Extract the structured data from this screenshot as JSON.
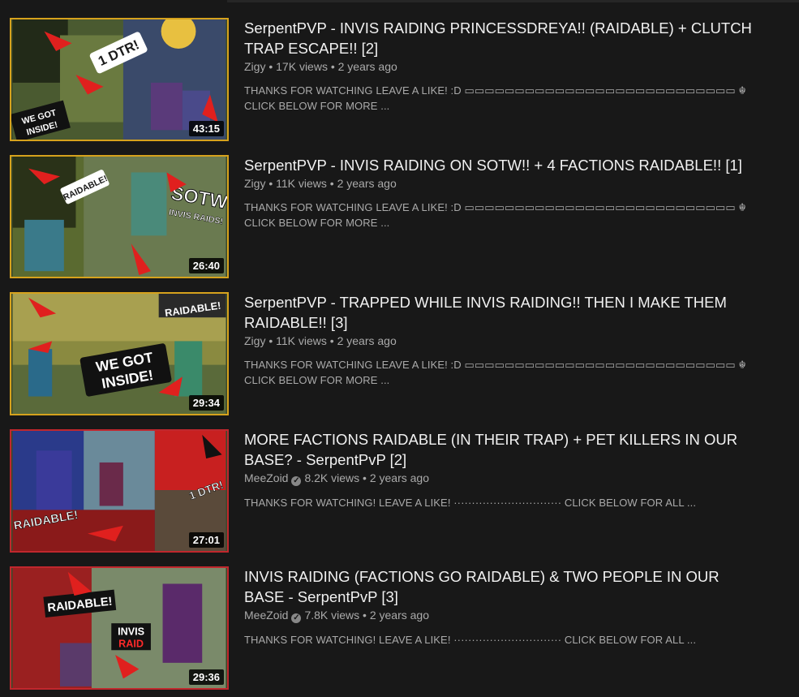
{
  "videos": [
    {
      "title": "SerpentPVP - INVIS RAIDING PRINCESSDREYA!! (RAIDABLE) + CLUTCH TRAP ESCAPE!! [2]",
      "channel": "Zigy",
      "verified": false,
      "stats": "17K views • 2 years ago",
      "description_line1": "THANKS FOR WATCHING LEAVE A LIKE! :D ▭▭▭▭▭▭▭▭▭▭▭▭▭▭▭▭▭▭▭▭▭▭▭▭▭▭▭ ☬",
      "description_line2": "CLICK BELOW FOR MORE ...",
      "duration": "43:15",
      "thumb_texts": [
        "1 DTR!",
        "WE GOT INSIDE!"
      ]
    },
    {
      "title": "SerpentPVP - INVIS RAIDING ON SOTW!! + 4 FACTIONS RAIDABLE!! [1]",
      "channel": "Zigy",
      "verified": false,
      "stats": "11K views • 2 years ago",
      "description_line1": "THANKS FOR WATCHING LEAVE A LIKE! :D ▭▭▭▭▭▭▭▭▭▭▭▭▭▭▭▭▭▭▭▭▭▭▭▭▭▭▭ ☬",
      "description_line2": "CLICK BELOW FOR MORE ...",
      "duration": "26:40",
      "thumb_texts": [
        "RAIDABLE!",
        "SOTW",
        "INVIS RAIDS!"
      ]
    },
    {
      "title": "SerpentPVP - TRAPPED WHILE INVIS RAIDING!! THEN I MAKE THEM RAIDABLE!! [3]",
      "channel": "Zigy",
      "verified": false,
      "stats": "11K views • 2 years ago",
      "description_line1": "THANKS FOR WATCHING LEAVE A LIKE! :D ▭▭▭▭▭▭▭▭▭▭▭▭▭▭▭▭▭▭▭▭▭▭▭▭▭▭▭ ☬",
      "description_line2": "CLICK BELOW FOR MORE ...",
      "duration": "29:34",
      "thumb_texts": [
        "RAIDABLE!",
        "WE GOT INSIDE!"
      ]
    },
    {
      "title": "MORE FACTIONS RAIDABLE (IN THEIR TRAP) + PET KILLERS IN OUR BASE? - SerpentPvP [2]",
      "channel": "MeeZoid",
      "verified": true,
      "stats": "8.2K views • 2 years ago",
      "description_line1": "THANKS FOR WATCHING! LEAVE A LIKE! ······························ CLICK BELOW FOR ALL ...",
      "description_line2": "",
      "duration": "27:01",
      "thumb_texts": [
        "RAIDABLE!",
        "1 DTR!"
      ]
    },
    {
      "title": "INVIS RAIDING (FACTIONS GO RAIDABLE) & TWO PEOPLE IN OUR BASE - SerpentPvP [3]",
      "channel": "MeeZoid",
      "verified": true,
      "stats": "7.8K views • 2 years ago",
      "description_line1": "THANKS FOR WATCHING! LEAVE A LIKE! ······························ CLICK BELOW FOR ALL ...",
      "description_line2": "",
      "duration": "29:36",
      "thumb_texts": [
        "RAIDABLE!",
        "INVIS RAID"
      ]
    }
  ],
  "colors": {
    "background": "#181818",
    "title": "#f1f1f1",
    "meta": "#aaaaaa",
    "thumb_border": "#d6a21d",
    "thumb_border_alt": "#c0272d"
  }
}
